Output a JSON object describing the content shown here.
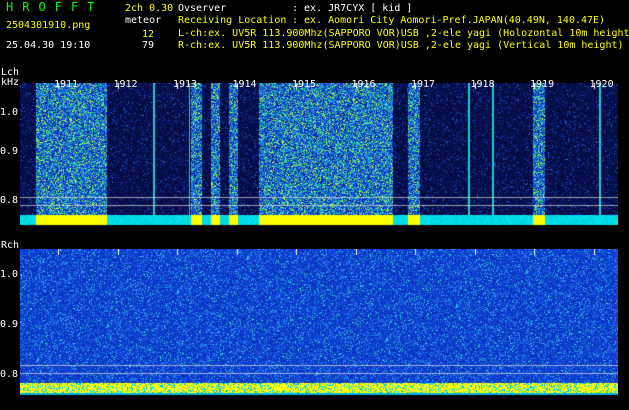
{
  "header": {
    "logo": "HROFFT",
    "filename": "2504301910.png",
    "datetime": "25.04.30 19:10",
    "version": "2ch 0.30",
    "mode": "meteor",
    "lch_count": "12",
    "rch_count": "79"
  },
  "info": {
    "observer_label": "Ovserver",
    "observer_value": ": ex. JR7CYX [ kid ]",
    "location_label": "Receiving Location",
    "location_value": ": ex. Aomori City Aomori-Pref.JAPAN(40.49N, 140.47E)",
    "lch_line": "L-ch:ex. UV5R 113.900Mhz(SAPPORO VOR)USB ,2-ele yagi (Holozontal 10m height)",
    "rch_line": "R-ch:ex. UV5R 113.900Mhz(SAPPORO VOR)USB ,2-ele yagi (Vertical 10m height)"
  },
  "lch_panel": {
    "title": "Lch",
    "unit": "kHz",
    "yticks": [
      "1.0",
      "0.9",
      "0.8"
    ]
  },
  "rch_panel": {
    "title": "Rch",
    "yticks": [
      "1.0",
      "0.9",
      "0.8"
    ]
  },
  "hours": [
    "1911",
    "1912",
    "1913",
    "1914",
    "1915",
    "1916",
    "1917",
    "1918",
    "1919",
    "1920"
  ],
  "activity": {
    "lch_bursts_min": [
      [
        0,
        1.2
      ],
      [
        2.6,
        2.8
      ],
      [
        2.95,
        3.1
      ],
      [
        3.25,
        3.4
      ],
      [
        3.75,
        6.0
      ],
      [
        6.25,
        6.45
      ],
      [
        8.35,
        8.55
      ]
    ],
    "lch_meteor_streaks_min": [
      1.6,
      2.2,
      4.0,
      5.6,
      6.9,
      7.3,
      8.0,
      9.1,
      9.6
    ],
    "rch_level": "continuous noise"
  },
  "colors": {
    "background": "#000000",
    "text_yellow": "#ffff00",
    "text_cyan": "#00ffff",
    "noise_blue": "#1a3fd0",
    "noise_dark": "#0a1050",
    "baseline_yellow": "#ffff00",
    "hot_green": "#20ff60"
  }
}
